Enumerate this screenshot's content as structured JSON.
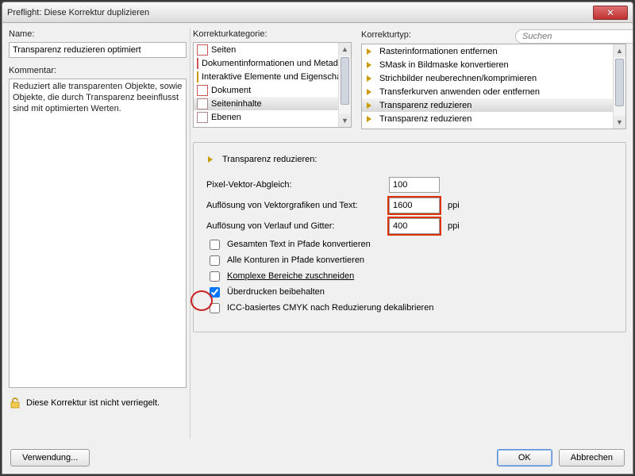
{
  "window": {
    "title": "Preflight: Diese Korrektur duplizieren"
  },
  "left": {
    "name_label": "Name:",
    "name_value": "Transparenz reduzieren optimiert",
    "comment_label": "Kommentar:",
    "comment_value": "Reduziert alle transparenten Objekte, sowie Objekte, die durch Transparenz beeinflusst sind mit optimierten Werten.",
    "lock_text": "Diese Korrektur ist nicht verriegelt."
  },
  "right": {
    "category_label": "Korrekturkategorie:",
    "categories": [
      "Seiten",
      "Dokumentinformationen und Metadaten",
      "Interaktive Elemente und Eigenschaften",
      "Dokument",
      "Seiteninhalte",
      "Ebenen"
    ],
    "type_label": "Korrekturtyp:",
    "search_placeholder": "Suchen",
    "types": [
      "Rasterinformationen entfernen",
      "SMask in Bildmaske konvertieren",
      "Strichbilder neuberechnen/komprimieren",
      "Transferkurven anwenden oder entfernen",
      "Transparenz reduzieren",
      "Transparenz reduzieren"
    ]
  },
  "params": {
    "title": "Transparenz reduzieren:",
    "pixel_vector_label": "Pixel-Vektor-Abgleich:",
    "pixel_vector_value": "100",
    "vector_res_label": "Auflösung von Vektorgrafiken und Text:",
    "vector_res_value": "1600",
    "gradient_res_label": "Auflösung von Verlauf und Gitter:",
    "gradient_res_value": "400",
    "unit": "ppi",
    "chk_text_paths": "Gesamten Text in Pfade konvertieren",
    "chk_outlines_paths": "Alle Konturen in Pfade konvertieren",
    "chk_clip_complex": "Komplexe Bereiche zuschneiden",
    "chk_overprint": "Überdrucken beibehalten",
    "chk_icc_cmyk": "ICC-basiertes CMYK nach Reduzierung dekalibrieren"
  },
  "footer": {
    "usage": "Verwendung...",
    "ok": "OK",
    "cancel": "Abbrechen"
  }
}
